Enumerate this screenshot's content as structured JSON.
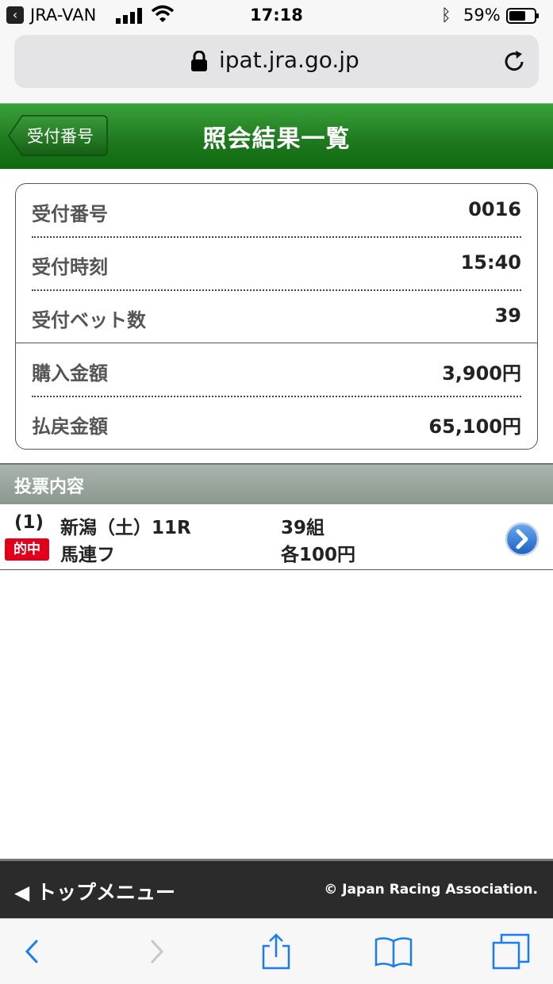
{
  "status_bar": {
    "back_app": "JRA-VAN",
    "time": "17:18",
    "battery_pct": "59%",
    "back_icon": "chevron-left-icon",
    "icons": [
      "signal-icon",
      "wifi-icon",
      "bluetooth-icon",
      "battery-icon"
    ]
  },
  "address_bar": {
    "url": "ipat.jra.go.jp",
    "icons": [
      "lock-icon",
      "reload-icon"
    ]
  },
  "header": {
    "back_label": "受付番号",
    "title": "照会結果一覧",
    "accent_color": "#1f7a1f"
  },
  "summary": {
    "rows": [
      {
        "label": "受付番号",
        "value": "0016"
      },
      {
        "label": "受付時刻",
        "value": "15:40"
      },
      {
        "label": "受付ベット数",
        "value": "39"
      },
      {
        "label": "購入金額",
        "value": "3,900円"
      },
      {
        "label": "払戻金額",
        "value": "65,100円"
      }
    ]
  },
  "section": {
    "title": "投票内容"
  },
  "vote": {
    "index": "(1)",
    "race": "新潟（土）11R",
    "combos": "39組",
    "hit_badge": "的中",
    "bet_type": "馬連フ",
    "amount_each": "各100円",
    "badge_color": "#e0001a",
    "detail_icon": "chevron-right-circle-icon"
  },
  "footer": {
    "menu_label": "トップメニュー",
    "copyright": "© Japan Racing Association."
  },
  "toolbar": {
    "icons": [
      "back-icon",
      "forward-icon",
      "share-icon",
      "bookmarks-icon",
      "tabs-icon"
    ]
  }
}
